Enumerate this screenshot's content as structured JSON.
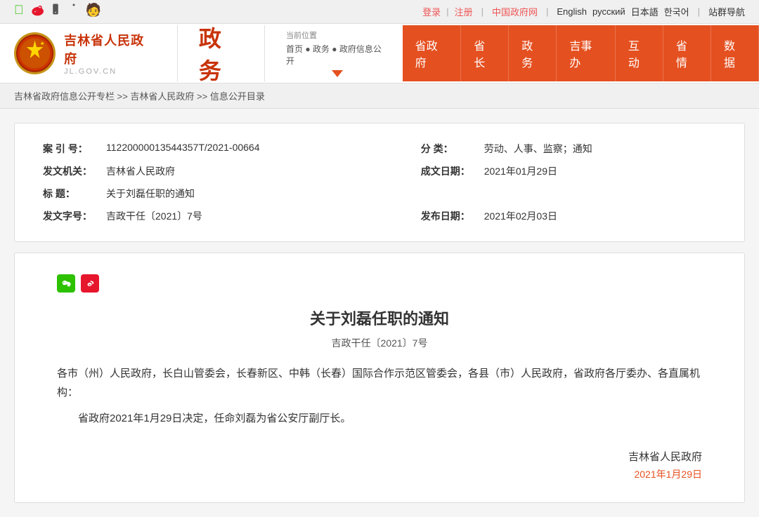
{
  "topbar": {
    "login": "登录",
    "register": "注册",
    "gov_cn": "中国政府网",
    "english": "English",
    "russian": "русский",
    "japanese": "日本語",
    "korean": "한국어",
    "nav": "站群导航",
    "sep": "|"
  },
  "header": {
    "site_title": "吉林省人民政府",
    "site_url": "JL.GOV.CN",
    "section": "政务",
    "current_position": "当前位置",
    "breadcrumb": {
      "home": "首页",
      "section": "政务",
      "sub": "政府信息公开"
    }
  },
  "nav": {
    "items": [
      {
        "label": "省政府"
      },
      {
        "label": "省长"
      },
      {
        "label": "政务"
      },
      {
        "label": "吉事办"
      },
      {
        "label": "互动"
      },
      {
        "label": "省情"
      },
      {
        "label": "数据"
      }
    ]
  },
  "sub_breadcrumb": {
    "text": "吉林省政府信息公开专栏 >> 吉林省人民政府 >> 信息公开目录"
  },
  "info_table": {
    "rows": [
      {
        "label1": "案 引 号：",
        "value1": "11220000013544357T/2021-00664",
        "label2": "分    类：",
        "value2": "劳动、人事、监察；通知"
      },
      {
        "label1": "发文机关：",
        "value1": "吉林省人民政府",
        "label2": "成文日期：",
        "value2": "2021年01月29日"
      },
      {
        "label1": "标    题：",
        "value1": "关于刘磊任职的通知",
        "label2": "",
        "value2": ""
      },
      {
        "label1": "发文字号：",
        "value1": "吉政干任〔2021〕7号",
        "label2": "发布日期：",
        "value2": "2021年02月03日"
      }
    ]
  },
  "document": {
    "title": "关于刘磊任职的通知",
    "number": "吉政干任〔2021〕7号",
    "recipient": "各市（州）人民政府，长白山管委会，长春新区、中韩（长春）国际合作示范区管委会，各县（市）人民政府，省政府各厅委办、各直属机构：",
    "body": "省政府2021年1月29日决定，任命刘磊为省公安厅副厅长。",
    "signature": "吉林省人民政府",
    "date": "2021年1月29日"
  }
}
